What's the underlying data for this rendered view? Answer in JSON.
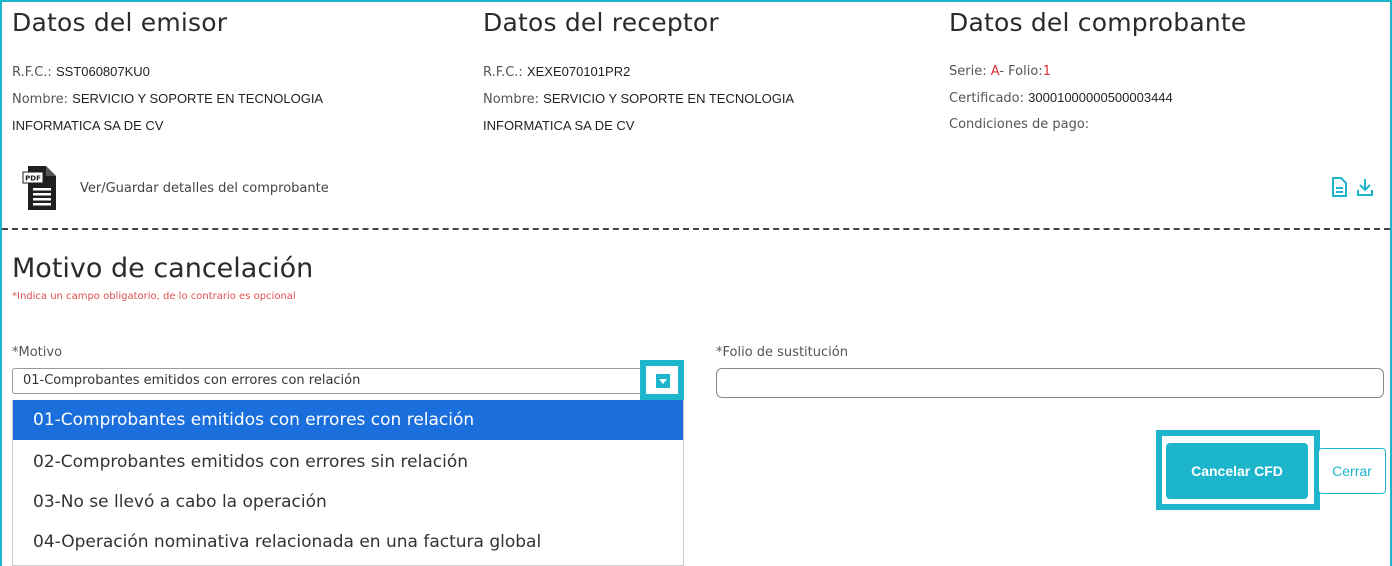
{
  "emisor": {
    "title": "Datos del emisor",
    "rfc_label": "R.F.C.:",
    "rfc": "SST060807KU0",
    "nombre_label": "Nombre:",
    "nombre_line1": "SERVICIO Y SOPORTE EN TECNOLOGIA",
    "nombre_line2": "INFORMATICA SA DE CV"
  },
  "receptor": {
    "title": "Datos del receptor",
    "rfc_label": "R.F.C.:",
    "rfc": "XEXE070101PR2",
    "nombre_label": "Nombre:",
    "nombre_line1": "SERVICIO Y SOPORTE EN TECNOLOGIA",
    "nombre_line2": "INFORMATICA SA DE CV"
  },
  "comprobante": {
    "title": "Datos del comprobante",
    "serie_label": "Serie:",
    "serie": "A",
    "folio_label": "- Folio:",
    "folio": "1",
    "certificado_label": "Certificado:",
    "certificado": "30001000000500003444",
    "condiciones_label": "Condiciones de pago:"
  },
  "pdf_link": {
    "label": "Ver/Guardar detalles del comprobante",
    "icon": "pdf-icon"
  },
  "doc_actions": {
    "view_icon": "document-icon",
    "download_icon": "download-icon"
  },
  "cancelacion": {
    "title": "Motivo de cancelación",
    "required_note": "*Indica un campo obligatorio, de lo contrario es opcional",
    "motivo_label": "*Motivo",
    "motivo_value": "01-Comprobantes emitidos con errores con relación",
    "motivo_options": [
      "01-Comprobantes emitidos con errores con relación",
      "02-Comprobantes emitidos con errores sin relación",
      "03-No se llevó a cabo la operación",
      "04-Operación nominativa relacionada en una factura global"
    ],
    "folio_label": "*Folio de sustitución",
    "folio_value": ""
  },
  "actions": {
    "cancel_label": "Cancelar CFD",
    "close_label": "Cerrar"
  },
  "colors": {
    "accent": "#1db5cc",
    "selected": "#1a6fdc",
    "required": "#e05050"
  }
}
